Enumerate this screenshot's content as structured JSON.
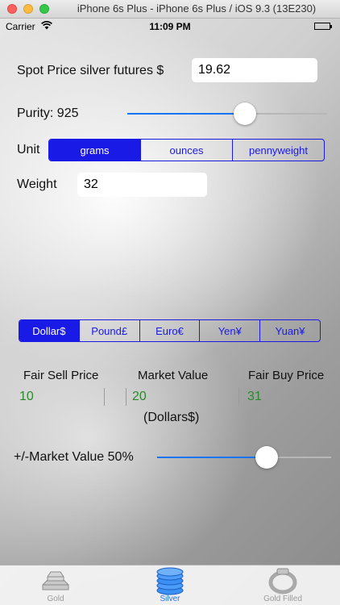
{
  "window": {
    "title": "iPhone 6s Plus - iPhone 6s Plus / iOS 9.3 (13E230)"
  },
  "status_bar": {
    "carrier": "Carrier",
    "time": "11:09 PM"
  },
  "spot_price": {
    "label": "Spot Price silver futures $",
    "value": "19.62"
  },
  "purity": {
    "label": "Purity: 925",
    "slider_fraction": 0.6
  },
  "unit": {
    "label": "Unit",
    "options": [
      "grams",
      "ounces",
      "pennyweight"
    ],
    "selected": "grams"
  },
  "weight": {
    "label": "Weight",
    "value": "32"
  },
  "currency": {
    "options": [
      "Dollar$",
      "Pound£",
      "Euro€",
      "Yen¥",
      "Yuan¥"
    ],
    "selected": "Dollar$"
  },
  "results": {
    "fair_sell": {
      "label": "Fair Sell Price",
      "value": "10"
    },
    "market_value": {
      "label": "Market Value",
      "value": "20"
    },
    "fair_buy": {
      "label": "Fair Buy Price",
      "value": "31"
    },
    "currency_note": "(Dollars$)"
  },
  "market_adjust": {
    "label": "+/-Market Value 50%",
    "slider_fraction": 0.65
  },
  "tabs": [
    {
      "label": "Gold",
      "icon": "gold-bars-icon",
      "active": false
    },
    {
      "label": "Silver",
      "icon": "silver-coins-icon",
      "active": true
    },
    {
      "label": "Gold Filled",
      "icon": "ring-icon",
      "active": false
    }
  ],
  "colors": {
    "accent": "#1a1ae6",
    "slider_track": "#1a74f2",
    "value_text": "#2a8a2a"
  }
}
